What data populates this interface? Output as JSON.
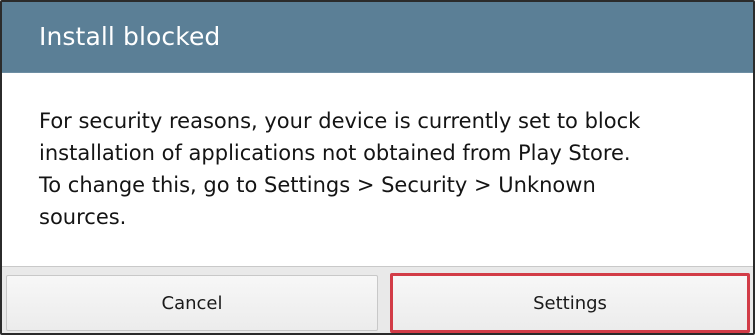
{
  "dialog": {
    "title": "Install blocked",
    "message_lines": [
      "For security reasons, your device is currently set to block",
      "installation of applications not obtained from Play Store.",
      "To change this, go to Settings > Security > Unknown",
      "sources."
    ],
    "buttons": {
      "cancel_label": "Cancel",
      "settings_label": "Settings"
    }
  },
  "colors": {
    "title_bar": "#5b7f96",
    "highlight_border": "#d23c47"
  }
}
